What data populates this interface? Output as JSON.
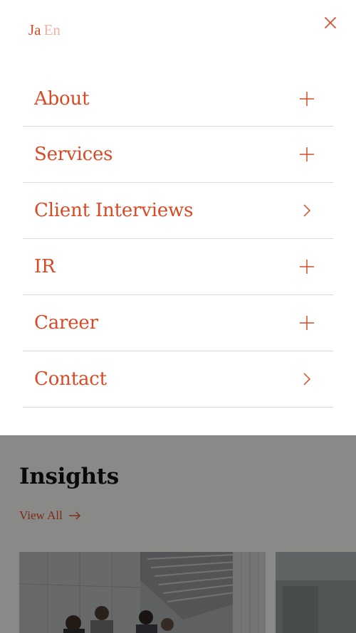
{
  "colors": {
    "accent": "#d94a24",
    "accent_light": "#efb3a2",
    "divider": "#d9d9d9",
    "overlay": "rgba(0,0,0,0.42)"
  },
  "language_switch": {
    "ja": "Ja",
    "en": "En",
    "active": "Ja"
  },
  "close_icon": "close-icon",
  "menu": {
    "items": [
      {
        "label": "About",
        "icon": "plus-icon"
      },
      {
        "label": "Services",
        "icon": "plus-icon"
      },
      {
        "label": "Client Interviews",
        "icon": "chevron-right-icon"
      },
      {
        "label": "IR",
        "icon": "plus-icon"
      },
      {
        "label": "Career",
        "icon": "plus-icon"
      },
      {
        "label": "Contact",
        "icon": "chevron-right-icon"
      }
    ]
  },
  "insights": {
    "title": "Insights",
    "view_all": "View All",
    "arrow_icon": "arrow-right-icon"
  }
}
